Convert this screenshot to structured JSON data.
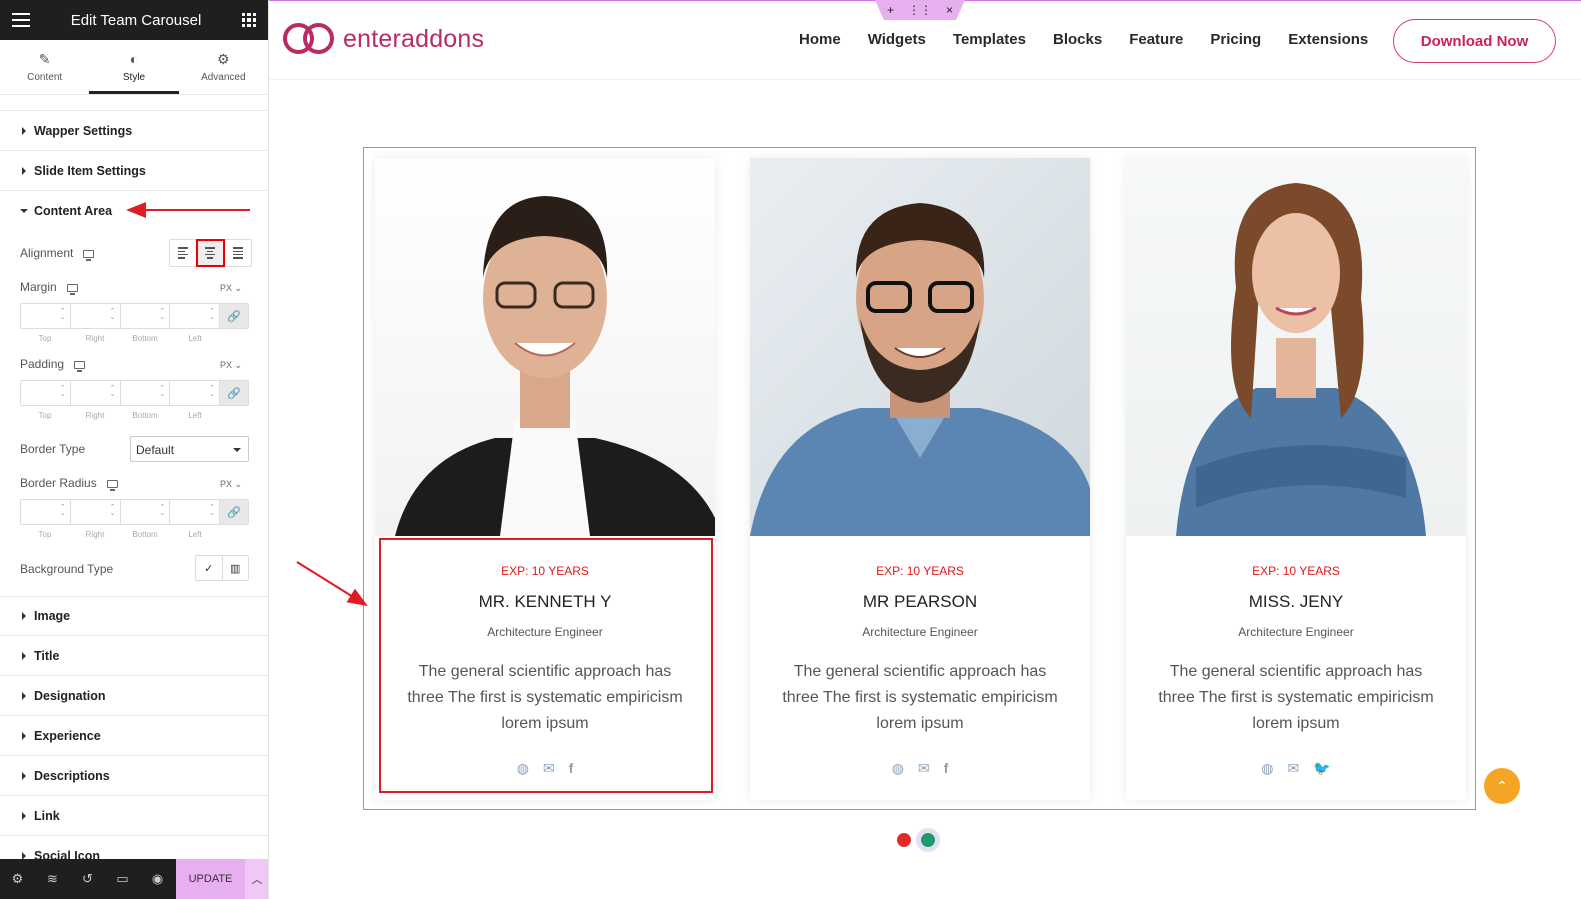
{
  "panel": {
    "title": "Edit Team Carousel",
    "tabs": [
      {
        "label": "Content",
        "icon": "pencil-icon"
      },
      {
        "label": "Style",
        "icon": "contrast-icon"
      },
      {
        "label": "Advanced",
        "icon": "gear-icon"
      }
    ],
    "sections_top": [
      "Wapper Settings",
      "Slide Item Settings",
      "Content Area"
    ],
    "controls": {
      "alignment": "Alignment",
      "margin": "Margin",
      "padding": "Padding",
      "border_type": "Border Type",
      "border_type_value": "Default",
      "border_radius": "Border Radius",
      "background_type": "Background Type",
      "unit": "PX",
      "dims": [
        "Top",
        "Right",
        "Bottom",
        "Left"
      ]
    },
    "sections_bottom": [
      "Image",
      "Title",
      "Designation",
      "Experience",
      "Descriptions",
      "Link",
      "Social Icon"
    ],
    "update": "UPDATE"
  },
  "site": {
    "logo": "enteraddons",
    "nav": [
      "Home",
      "Widgets",
      "Templates",
      "Blocks",
      "Feature",
      "Pricing",
      "Extensions"
    ],
    "cta": "Download Now"
  },
  "team": [
    {
      "exp": "EXP: 10 YEARS",
      "name": "MR. KENNETH Y",
      "role": "Architecture Engineer",
      "desc": "The general scientific approach has three The first is systematic empiricism lorem ipsum",
      "social": [
        "globe-icon",
        "mail-icon",
        "facebook-icon"
      ]
    },
    {
      "exp": "EXP: 10 YEARS",
      "name": "MR PEARSON",
      "role": "Architecture Engineer",
      "desc": "The general scientific approach has three The first is systematic empiricism lorem ipsum",
      "social": [
        "globe-icon",
        "mail-icon",
        "facebook-icon"
      ]
    },
    {
      "exp": "EXP: 10 YEARS",
      "name": "MISS. JENY",
      "role": "Architecture Engineer",
      "desc": "The general scientific approach has three The first is systematic empiricism lorem ipsum",
      "social": [
        "globe-icon",
        "mail-icon",
        "twitter-icon"
      ]
    }
  ],
  "colors": {
    "accent": "#b92c63",
    "exp": "#e01818",
    "highlight": "#e01b24",
    "dot_red": "#e02a2a",
    "dot_green": "#1e9a6e",
    "scroll_top": "#f5a524"
  }
}
